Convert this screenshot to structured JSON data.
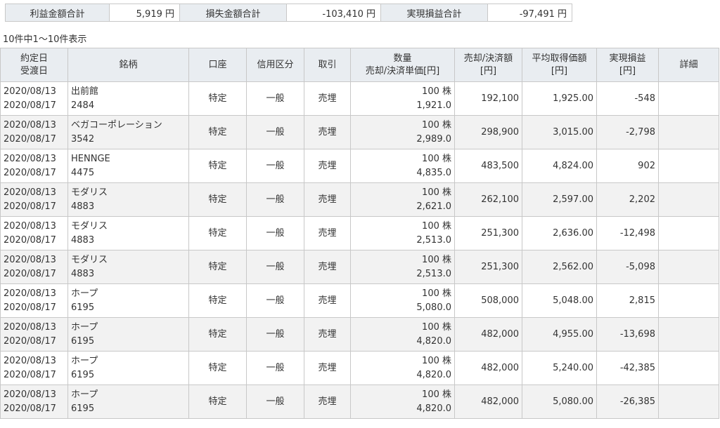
{
  "summary": {
    "profit_label": "利益金額合計",
    "profit_value": "5,919 円",
    "loss_label": "損失金額合計",
    "loss_value": "-103,410 円",
    "realized_label": "実現損益合計",
    "realized_value": "-97,491 円"
  },
  "result_count": "10件中1～10件表示",
  "headers": {
    "date1": "約定日",
    "date2": "受渡日",
    "name": "銘柄",
    "account": "口座",
    "credit": "信用区分",
    "trade": "取引",
    "qty1": "数量",
    "qty2": "売却/決済単価[円]",
    "amount1": "売却/決済額",
    "amount2": "[円]",
    "avg1": "平均取得価額",
    "avg2": "[円]",
    "pnl1": "実現損益",
    "pnl2": "[円]",
    "detail": "詳細"
  },
  "rows": [
    {
      "trade_date": "2020/08/13",
      "settle_date": "2020/08/17",
      "name": "出前館",
      "code": "2484",
      "account": "特定",
      "credit": "一般",
      "trade": "売埋",
      "qty": "100 株",
      "price": "1,921.0",
      "amount": "192,100",
      "avg": "1,925.00",
      "pnl": "-548"
    },
    {
      "trade_date": "2020/08/13",
      "settle_date": "2020/08/17",
      "name": "ベガコーポレーション",
      "code": "3542",
      "account": "特定",
      "credit": "一般",
      "trade": "売埋",
      "qty": "100 株",
      "price": "2,989.0",
      "amount": "298,900",
      "avg": "3,015.00",
      "pnl": "-2,798"
    },
    {
      "trade_date": "2020/08/13",
      "settle_date": "2020/08/17",
      "name": "HENNGE",
      "code": "4475",
      "account": "特定",
      "credit": "一般",
      "trade": "売埋",
      "qty": "100 株",
      "price": "4,835.0",
      "amount": "483,500",
      "avg": "4,824.00",
      "pnl": "902"
    },
    {
      "trade_date": "2020/08/13",
      "settle_date": "2020/08/17",
      "name": "モダリス",
      "code": "4883",
      "account": "特定",
      "credit": "一般",
      "trade": "売埋",
      "qty": "100 株",
      "price": "2,621.0",
      "amount": "262,100",
      "avg": "2,597.00",
      "pnl": "2,202"
    },
    {
      "trade_date": "2020/08/13",
      "settle_date": "2020/08/17",
      "name": "モダリス",
      "code": "4883",
      "account": "特定",
      "credit": "一般",
      "trade": "売埋",
      "qty": "100 株",
      "price": "2,513.0",
      "amount": "251,300",
      "avg": "2,636.00",
      "pnl": "-12,498"
    },
    {
      "trade_date": "2020/08/13",
      "settle_date": "2020/08/17",
      "name": "モダリス",
      "code": "4883",
      "account": "特定",
      "credit": "一般",
      "trade": "売埋",
      "qty": "100 株",
      "price": "2,513.0",
      "amount": "251,300",
      "avg": "2,562.00",
      "pnl": "-5,098"
    },
    {
      "trade_date": "2020/08/13",
      "settle_date": "2020/08/17",
      "name": "ホープ",
      "code": "6195",
      "account": "特定",
      "credit": "一般",
      "trade": "売埋",
      "qty": "100 株",
      "price": "5,080.0",
      "amount": "508,000",
      "avg": "5,048.00",
      "pnl": "2,815"
    },
    {
      "trade_date": "2020/08/13",
      "settle_date": "2020/08/17",
      "name": "ホープ",
      "code": "6195",
      "account": "特定",
      "credit": "一般",
      "trade": "売埋",
      "qty": "100 株",
      "price": "4,820.0",
      "amount": "482,000",
      "avg": "4,955.00",
      "pnl": "-13,698"
    },
    {
      "trade_date": "2020/08/13",
      "settle_date": "2020/08/17",
      "name": "ホープ",
      "code": "6195",
      "account": "特定",
      "credit": "一般",
      "trade": "売埋",
      "qty": "100 株",
      "price": "4,820.0",
      "amount": "482,000",
      "avg": "5,240.00",
      "pnl": "-42,385"
    },
    {
      "trade_date": "2020/08/13",
      "settle_date": "2020/08/17",
      "name": "ホープ",
      "code": "6195",
      "account": "特定",
      "credit": "一般",
      "trade": "売埋",
      "qty": "100 株",
      "price": "4,820.0",
      "amount": "482,000",
      "avg": "5,080.00",
      "pnl": "-26,385"
    }
  ]
}
